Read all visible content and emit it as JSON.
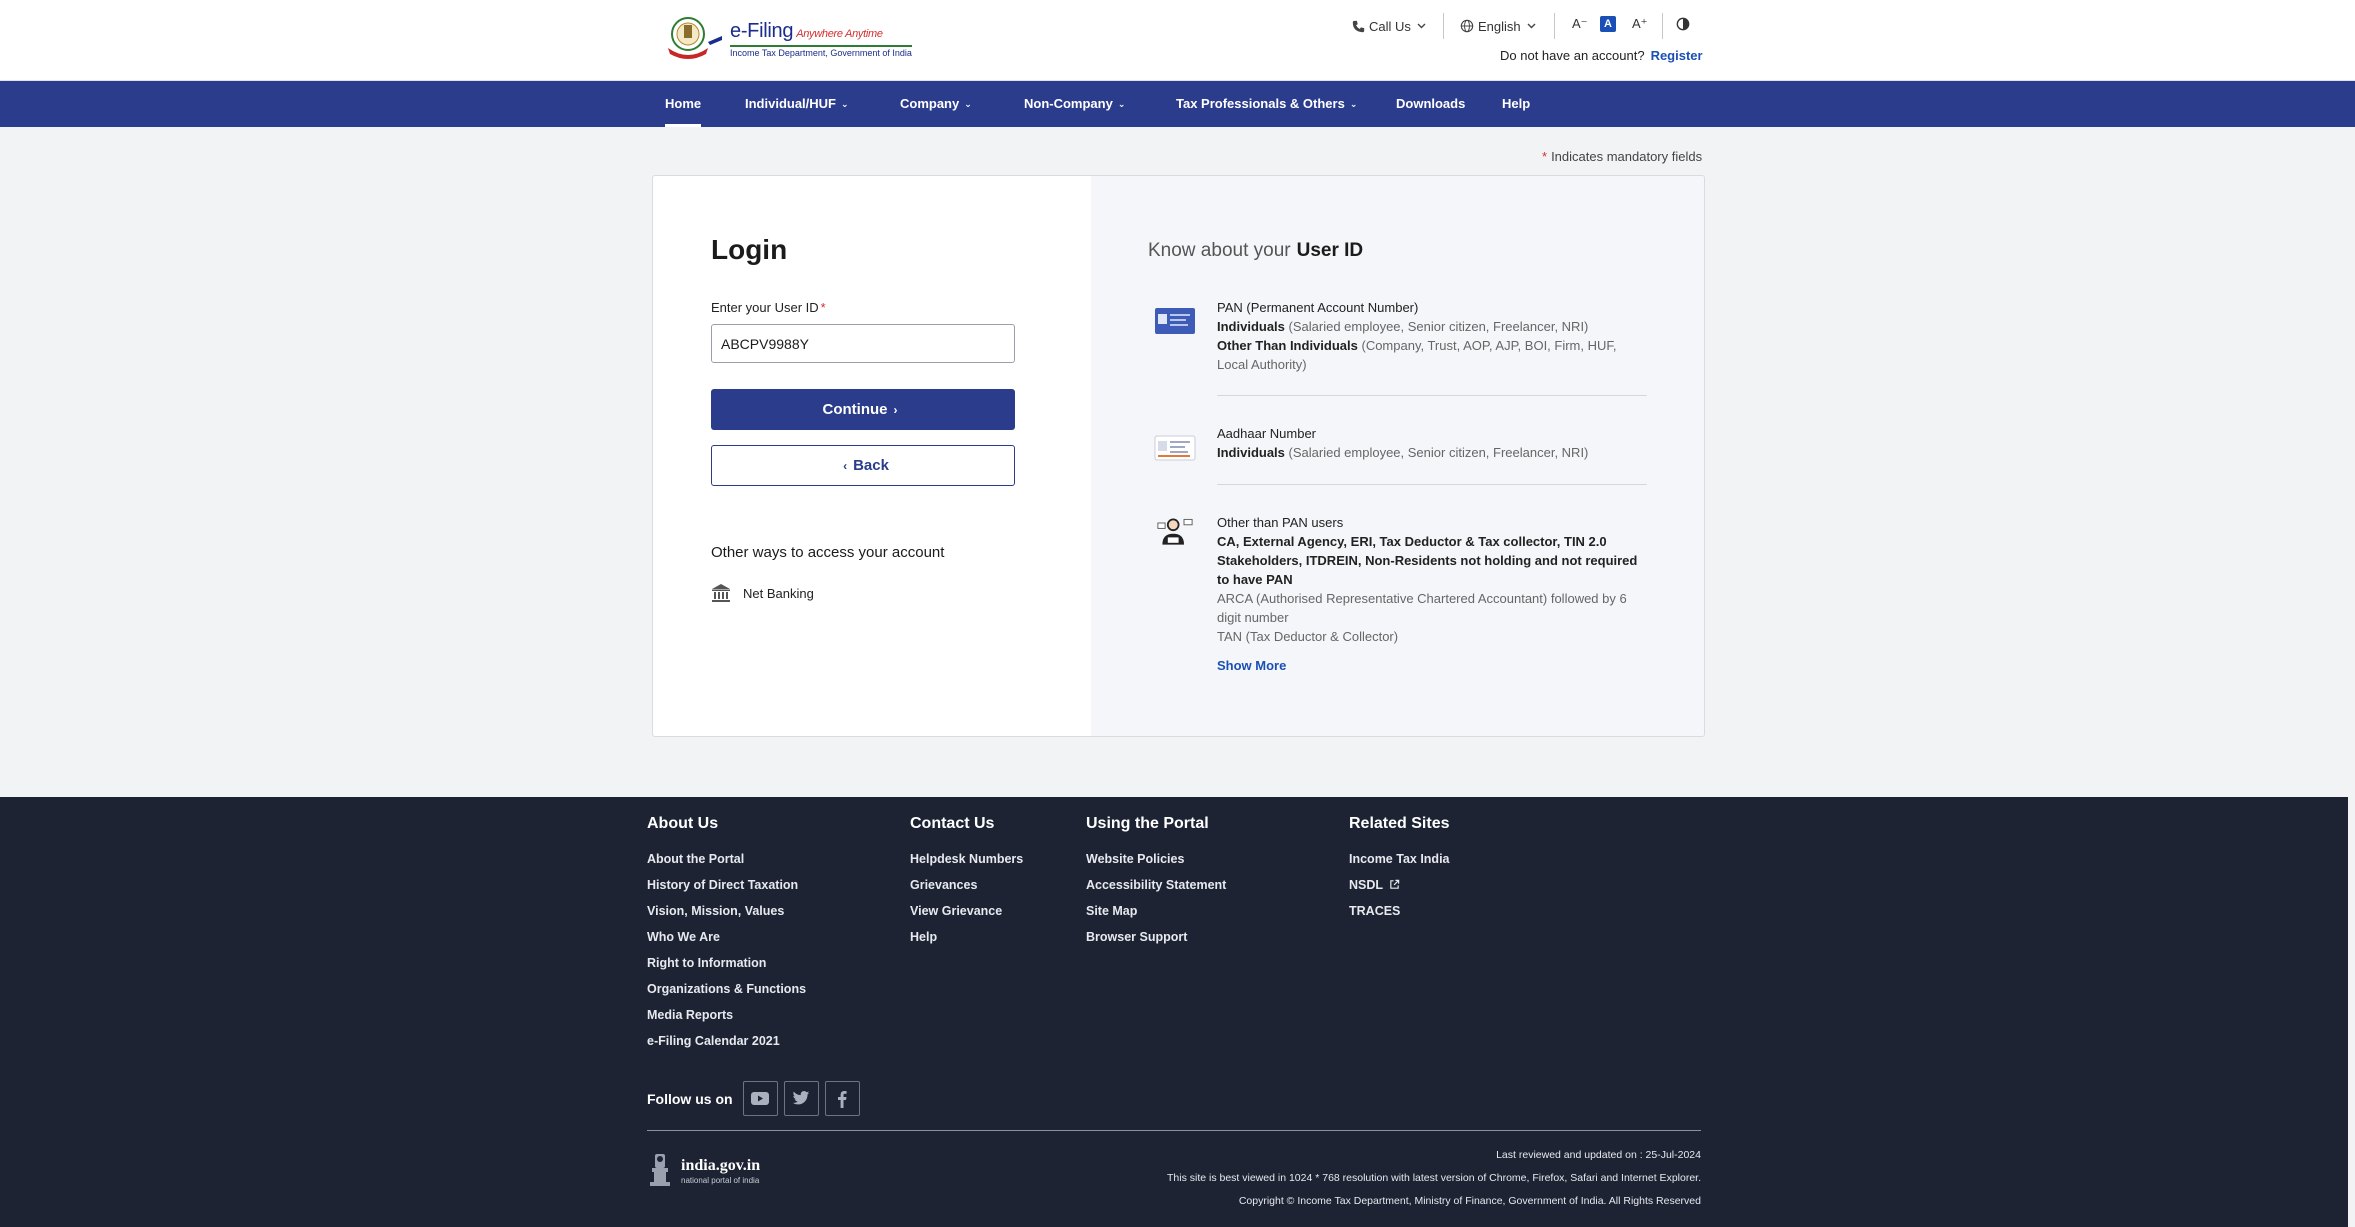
{
  "header": {
    "logo_title": "e-Filing",
    "logo_tagline": "Anywhere Anytime",
    "logo_subtitle": "Income Tax Department, Government of India",
    "call_us": "Call Us",
    "language": "English",
    "font_decrease": "A⁻",
    "font_default": "A",
    "font_increase": "A⁺",
    "no_account_text": "Do not have an account?",
    "register_label": "Register"
  },
  "nav": {
    "items": [
      {
        "label": "Home",
        "active": true
      },
      {
        "label": "Individual/HUF",
        "dropdown": true
      },
      {
        "label": "Company",
        "dropdown": true
      },
      {
        "label": "Non-Company",
        "dropdown": true
      },
      {
        "label": "Tax Professionals & Others",
        "dropdown": true
      },
      {
        "label": "Downloads"
      },
      {
        "label": "Help"
      }
    ]
  },
  "mandatory_note": "Indicates mandatory fields",
  "login": {
    "title": "Login",
    "user_id_label": "Enter your User ID",
    "user_id_value": "ABCPV9988Y",
    "continue_label": "Continue",
    "back_label": "Back",
    "other_ways_title": "Other ways to access your account",
    "net_banking_label": "Net Banking"
  },
  "know": {
    "title_prefix": "Know about your",
    "title_bold": "User ID",
    "pan": {
      "title": "PAN (Permanent Account Number)",
      "ind_bold": "Individuals",
      "ind_text": "(Salaried employee, Senior citizen, Freelancer, NRI)",
      "other_bold": "Other Than Individuals",
      "other_text": "(Company, Trust, AOP, AJP, BOI, Firm, HUF, Local Authority)"
    },
    "aadhaar": {
      "title": "Aadhaar Number",
      "ind_bold": "Individuals",
      "ind_text": "(Salaried employee, Senior citizen, Freelancer, NRI)"
    },
    "other_pan": {
      "title": "Other than PAN users",
      "bold_text": "CA, External Agency, ERI, Tax Deductor & Tax collector, TIN 2.0 Stakeholders, ITDREIN, Non-Residents not holding and not required to have PAN",
      "arca_text": "ARCA (Authorised Representative Chartered Accountant) followed by 6 digit number",
      "tan_text": "TAN (Tax Deductor & Collector)",
      "show_more": "Show More"
    }
  },
  "footer": {
    "about": {
      "heading": "About Us",
      "links": [
        "About the Portal",
        "History of Direct Taxation",
        "Vision, Mission, Values",
        "Who We Are",
        "Right to Information",
        "Organizations & Functions",
        "Media Reports",
        "e-Filing Calendar 2021"
      ]
    },
    "contact": {
      "heading": "Contact Us",
      "links": [
        "Helpdesk Numbers",
        "Grievances",
        "View Grievance",
        "Help"
      ]
    },
    "portal": {
      "heading": "Using the Portal",
      "links": [
        "Website Policies",
        "Accessibility Statement",
        "Site Map",
        "Browser Support"
      ]
    },
    "related": {
      "heading": "Related Sites",
      "links": [
        "Income Tax India",
        "NSDL",
        "TRACES"
      ]
    },
    "follow_label": "Follow us on",
    "india_gov_title": "india.gov.in",
    "india_gov_sub": "national portal of india",
    "last_reviewed": "Last reviewed and updated on : 25-Jul-2024",
    "best_viewed": "This site is best viewed in 1024 * 768 resolution with latest version of Chrome, Firefox, Safari and Internet Explorer.",
    "copyright": "Copyright © Income Tax Department, Ministry of Finance, Government of India. All Rights Reserved"
  },
  "colors": {
    "primary_navy": "#2b3c8c",
    "link_blue": "#1a4fb5",
    "required_red": "#d32f2f",
    "footer_bg": "#1d2333"
  }
}
